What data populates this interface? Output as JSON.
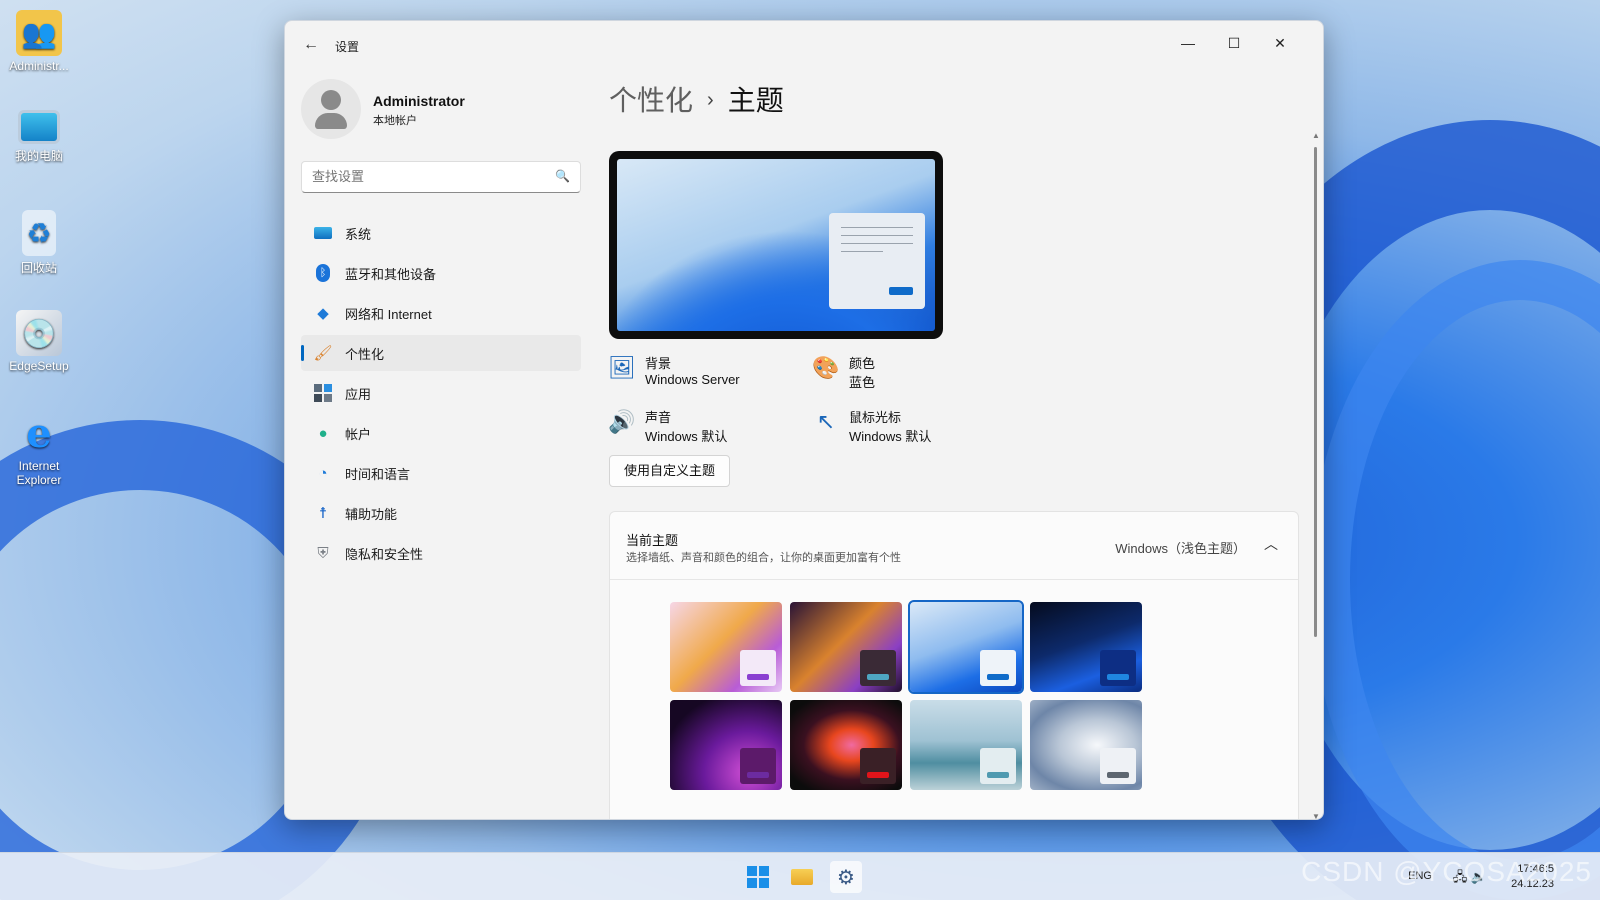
{
  "desktop": {
    "icons": [
      {
        "label": "Administr...",
        "icon": "user-folder-icon"
      },
      {
        "label": "我的电脑",
        "icon": "monitor-icon"
      },
      {
        "label": "回收站",
        "icon": "recycle-bin-icon"
      },
      {
        "label": "EdgeSetup",
        "icon": "installer-icon"
      },
      {
        "label": "Internet Explorer",
        "icon": "internet-explorer-icon"
      }
    ]
  },
  "window": {
    "title": "设置",
    "controls": {
      "minimize": "—",
      "maximize": "☐",
      "close": "✕"
    }
  },
  "profile": {
    "name": "Administrator",
    "account_type": "本地帐户"
  },
  "search": {
    "placeholder": "查找设置"
  },
  "nav": {
    "items": [
      {
        "label": "系统",
        "icon": "system-icon"
      },
      {
        "label": "蓝牙和其他设备",
        "icon": "bluetooth-icon"
      },
      {
        "label": "网络和 Internet",
        "icon": "wifi-icon"
      },
      {
        "label": "个性化",
        "icon": "brush-icon",
        "active": true
      },
      {
        "label": "应用",
        "icon": "apps-icon"
      },
      {
        "label": "帐户",
        "icon": "account-icon"
      },
      {
        "label": "时间和语言",
        "icon": "time-language-icon"
      },
      {
        "label": "辅助功能",
        "icon": "accessibility-icon"
      },
      {
        "label": "隐私和安全性",
        "icon": "shield-icon"
      }
    ]
  },
  "breadcrumb": {
    "parent": "个性化",
    "separator": "›",
    "current": "主题"
  },
  "properties": {
    "background": {
      "label": "背景",
      "value": "Windows Server"
    },
    "color": {
      "label": "颜色",
      "value": "蓝色"
    },
    "sound": {
      "label": "声音",
      "value": "Windows 默认"
    },
    "cursor": {
      "label": "鼠标光标",
      "value": "Windows 默认"
    }
  },
  "custom_theme_button": "使用自定义主题",
  "current_theme": {
    "title": "当前主题",
    "subtitle": "选择墙纸、声音和颜色的组合，让你的桌面更加富有个性",
    "value": "Windows（浅色主题）"
  },
  "themes": [
    {
      "name": "glow-light",
      "bg": "linear-gradient(135deg,#f6d6e6,#f0a94a 45%,#b85cd6 75%,#e7c9f5)",
      "card": "#f3e9f8",
      "accent": "#8a3fd1"
    },
    {
      "name": "glow-dark",
      "bg": "linear-gradient(135deg,#2a1436,#d9822e 45%,#8b3fc4 75%,#1f0f2a)",
      "card": "#3a2a36",
      "accent": "#4ea6c2"
    },
    {
      "name": "windows-light",
      "bg": "linear-gradient(160deg,#dbe9f7,#8fbcef 45%,#1d6ee6 75%,#0b47be)",
      "card": "#eef3f9",
      "accent": "#0f6bc9",
      "selected": true
    },
    {
      "name": "windows-dark",
      "bg": "linear-gradient(160deg,#050b1e,#0d2a6b 45%,#1b5fe0 75%,#0a2c80)",
      "card": "#0d2e84",
      "accent": "#1f86e0"
    },
    {
      "name": "captured-motion",
      "bg": "radial-gradient(ellipse at 70% 80%,#d24fd6,#6a1a9c 40%,#160723 80%)",
      "card": "#5c1a6a",
      "accent": "#6c2ba0"
    },
    {
      "name": "flow",
      "bg": "radial-gradient(ellipse at 55% 50%,#f06aa0,#e8461e 25%,#3a1020 55%,#0c0c0c 85%)",
      "card": "#3a2026",
      "accent": "#e0141a"
    },
    {
      "name": "sunrise",
      "bg": "linear-gradient(180deg,#c9dde8,#9fc2d3 45%,#4f8ea1 70%,#bcd2d8)",
      "card": "#e3edf0",
      "accent": "#4f9ab0"
    },
    {
      "name": "bloom",
      "bg": "radial-gradient(ellipse at 60% 50%,#f6f8fb,#b9c6d6 40%,#6e86a8 75%,#9fb0c6)",
      "card": "#eef1f5",
      "accent": "#5d6670"
    }
  ],
  "taskbar": {
    "items": [
      {
        "name": "start",
        "icon": "windows-start-icon"
      },
      {
        "name": "file-explorer",
        "icon": "folder-icon"
      },
      {
        "name": "settings",
        "icon": "gear-icon",
        "active": true
      }
    ],
    "language": "ENG",
    "time": "17:46:5",
    "date": "24.12.23"
  },
  "watermark": "CSDN @YCOSA2025"
}
